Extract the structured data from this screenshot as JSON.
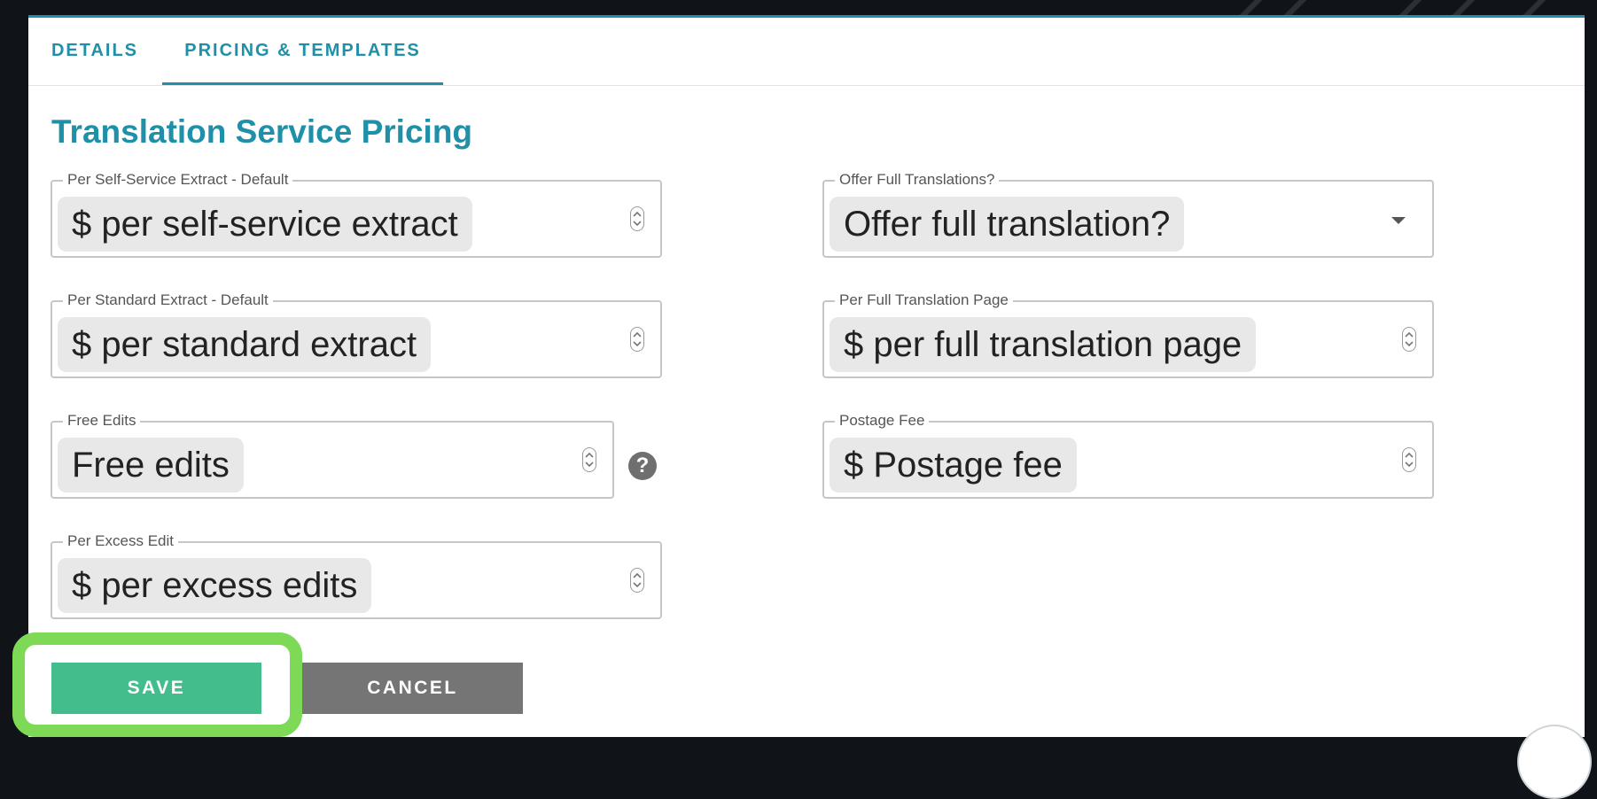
{
  "tabs": [
    {
      "label": "DETAILS"
    },
    {
      "label": "PRICING & TEMPLATES"
    }
  ],
  "section_title": "Translation Service Pricing",
  "fields": {
    "per_self_service_extract": {
      "label": "Per Self-Service Extract - Default",
      "placeholder": "$ per self-service extract"
    },
    "offer_full_translations": {
      "label": "Offer Full Translations?",
      "placeholder": "Offer full translation?"
    },
    "per_standard_extract": {
      "label": "Per Standard Extract - Default",
      "placeholder": "$ per standard extract"
    },
    "per_full_translation_page": {
      "label": "Per Full Translation Page",
      "placeholder": "$ per full translation page"
    },
    "free_edits": {
      "label": "Free Edits",
      "placeholder": "Free edits"
    },
    "postage_fee": {
      "label": "Postage Fee",
      "placeholder": "$ Postage fee"
    },
    "per_excess_edit": {
      "label": "Per Excess Edit",
      "placeholder": "$ per excess edits"
    }
  },
  "help_icon": {
    "glyph": "?"
  },
  "buttons": {
    "save": "SAVE",
    "cancel": "CANCEL"
  },
  "colors": {
    "accent": "#1f90a8",
    "save": "#44bd8d",
    "cancel": "#757575",
    "highlight": "#7dd956"
  }
}
